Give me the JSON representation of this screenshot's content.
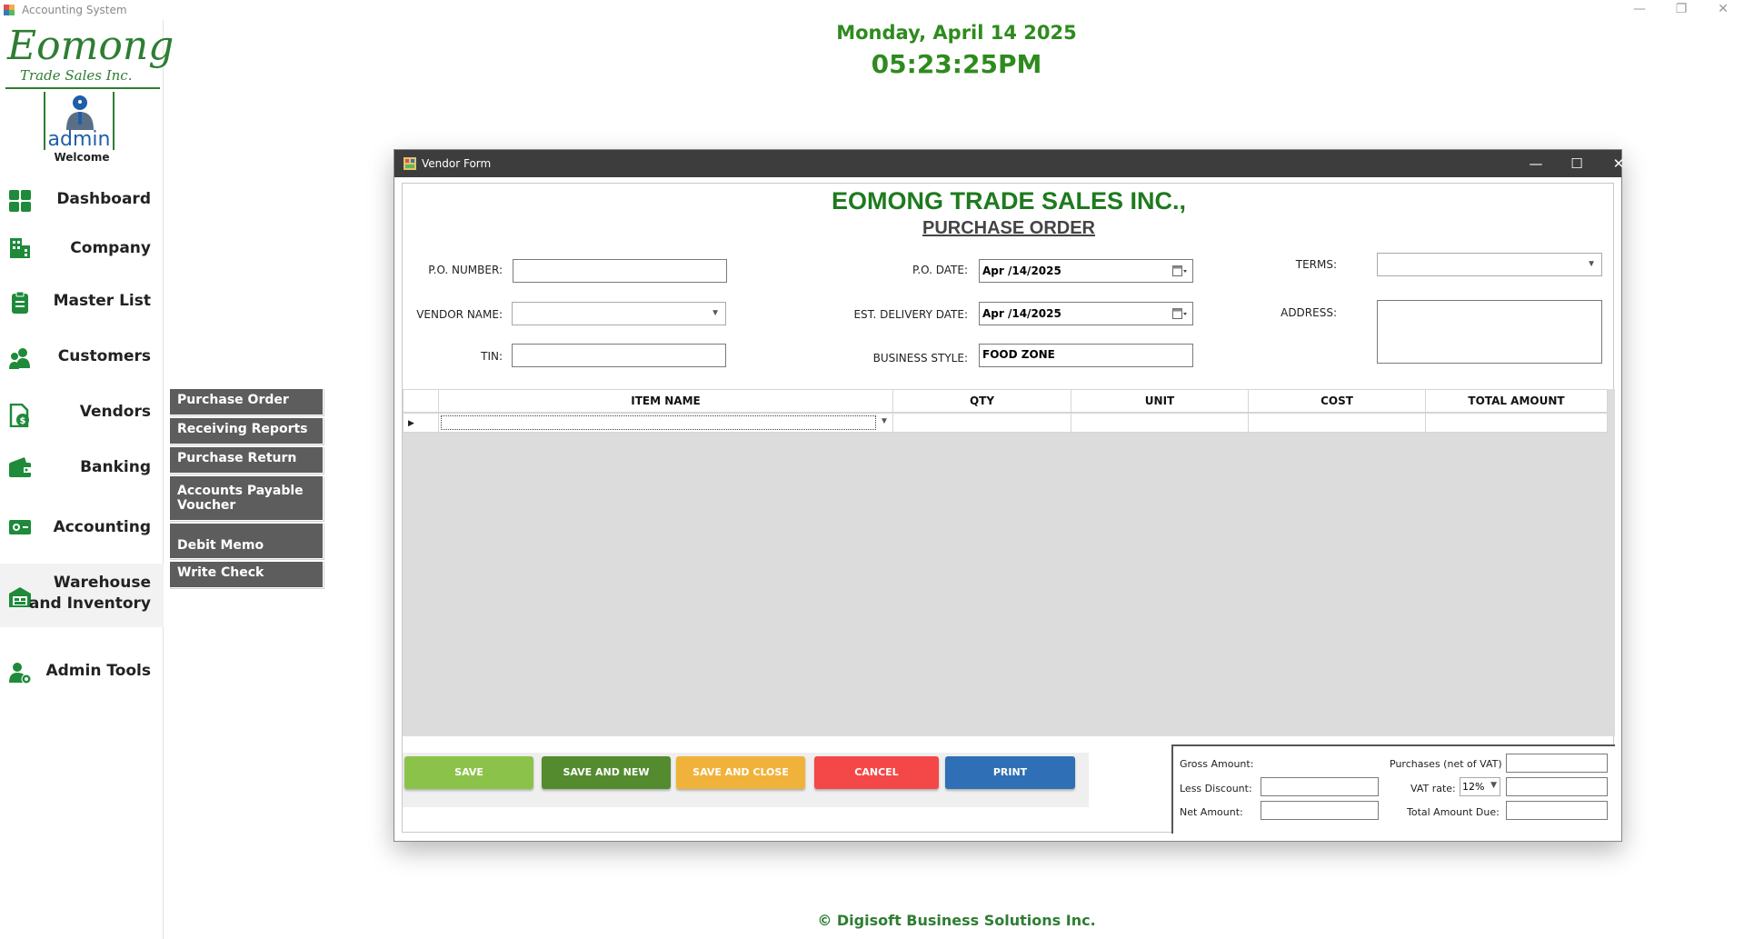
{
  "window": {
    "title": "Accounting System",
    "controls": {
      "minimize": "—",
      "restore": "❐",
      "close": "✕"
    }
  },
  "brand": {
    "logo_main": "Eomong",
    "logo_sub": "Trade Sales Inc.",
    "user": "admin",
    "welcome": "Welcome"
  },
  "header": {
    "date": "Monday, April 14 2025",
    "time": "05:23:25PM"
  },
  "sidebar": {
    "items": [
      {
        "label": "Dashboard",
        "icon": "dashboard-icon"
      },
      {
        "label": "Company",
        "icon": "building-icon"
      },
      {
        "label": "Master List",
        "icon": "clipboard-icon"
      },
      {
        "label": "Customers",
        "icon": "users-icon"
      },
      {
        "label": "Vendors",
        "icon": "dollar-document-icon"
      },
      {
        "label": "Banking",
        "icon": "wallet-icon"
      },
      {
        "label": "Accounting",
        "icon": "cash-icon"
      },
      {
        "label": "Warehouse and Inventory",
        "line1": "Warehouse",
        "line2": "and Inventory",
        "icon": "warehouse-icon"
      },
      {
        "label": "Admin Tools",
        "icon": "admin-gear-icon"
      }
    ]
  },
  "vendor_menu": {
    "items": [
      {
        "label": "Purchase Order"
      },
      {
        "label": "Receiving Reports"
      },
      {
        "label": "Purchase Return"
      },
      {
        "label": "Accounts Payable Voucher"
      },
      {
        "label": "Debit Memo"
      },
      {
        "label": "Write Check"
      }
    ]
  },
  "dialog": {
    "title": "Vendor Form",
    "company": "EOMONG TRADE SALES INC.,",
    "form_title": "PURCHASE ORDER",
    "fields": {
      "po_number": {
        "label": "P.O. NUMBER:",
        "value": ""
      },
      "vendor_name": {
        "label": "VENDOR NAME:",
        "value": ""
      },
      "tin": {
        "label": "TIN:",
        "value": ""
      },
      "po_date": {
        "label": "P.O. DATE:",
        "value": "Apr /14/2025"
      },
      "est_delivery": {
        "label": "EST. DELIVERY DATE:",
        "value": "Apr /14/2025"
      },
      "business_style": {
        "label": "BUSINESS STYLE:",
        "value": "FOOD ZONE"
      },
      "terms": {
        "label": "TERMS:",
        "value": ""
      },
      "address": {
        "label": "ADDRESS:",
        "value": ""
      }
    },
    "grid": {
      "columns": [
        "ITEM NAME",
        "QTY",
        "UNIT",
        "COST",
        "TOTAL AMOUNT"
      ],
      "rows": [
        {
          "item_name": "",
          "qty": "",
          "unit": "",
          "cost": "",
          "total": ""
        }
      ]
    },
    "buttons": {
      "save": "SAVE",
      "save_new": "SAVE AND NEW",
      "save_close": "SAVE AND CLOSE",
      "cancel": "CANCEL",
      "print": "PRINT"
    },
    "totals": {
      "gross_amount": "Gross Amount:",
      "less_discount": "Less Discount:",
      "net_amount": "Net Amount:",
      "purchases_net_vat": "Purchases (net of VAT)",
      "vat_rate": "VAT rate:",
      "vat_rate_value": "12%",
      "total_amount_due": "Total Amount Due:"
    }
  },
  "footer": "© Digisoft Business Solutions Inc.",
  "colors": {
    "brand_green": "#2e7d32",
    "title_green": "#1e7a1e",
    "submenu_bg": "#5d5d5d",
    "save": "#8bc34a",
    "save_new": "#558b2f",
    "save_close": "#f0b23a",
    "cancel": "#f44848",
    "print": "#2f6fb5"
  }
}
